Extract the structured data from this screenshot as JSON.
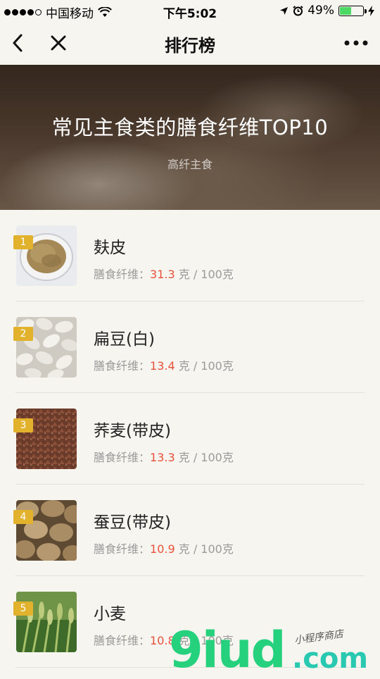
{
  "status_bar": {
    "carrier": "中国移动",
    "time": "下午5:02",
    "battery_percent": "49%",
    "battery_level": 0.49
  },
  "nav": {
    "title": "排行榜"
  },
  "banner": {
    "title": "常见主食类的膳食纤维TOP10",
    "subtitle": "高纤主食"
  },
  "items": [
    {
      "rank": "1",
      "name": "麸皮",
      "label": "膳食纤维：",
      "value": "31.3",
      "unit": " 克 / 100克"
    },
    {
      "rank": "2",
      "name": "扁豆(白)",
      "label": "膳食纤维：",
      "value": "13.4",
      "unit": " 克 / 100克"
    },
    {
      "rank": "3",
      "name": "荞麦(带皮)",
      "label": "膳食纤维：",
      "value": "13.3",
      "unit": " 克 / 100克"
    },
    {
      "rank": "4",
      "name": "蚕豆(带皮)",
      "label": "膳食纤维：",
      "value": "10.9",
      "unit": " 克 / 100克"
    },
    {
      "rank": "5",
      "name": "小麦",
      "label": "膳食纤维：",
      "value": "10.8",
      "unit": " 克 / 100克"
    }
  ],
  "watermark": {
    "brand": "9iud",
    "domain": ".com",
    "tagline": "小程序商店"
  },
  "colors": {
    "accent_value": "#e8513c",
    "badge": "#e2b22c",
    "background": "#f7f5ef"
  }
}
